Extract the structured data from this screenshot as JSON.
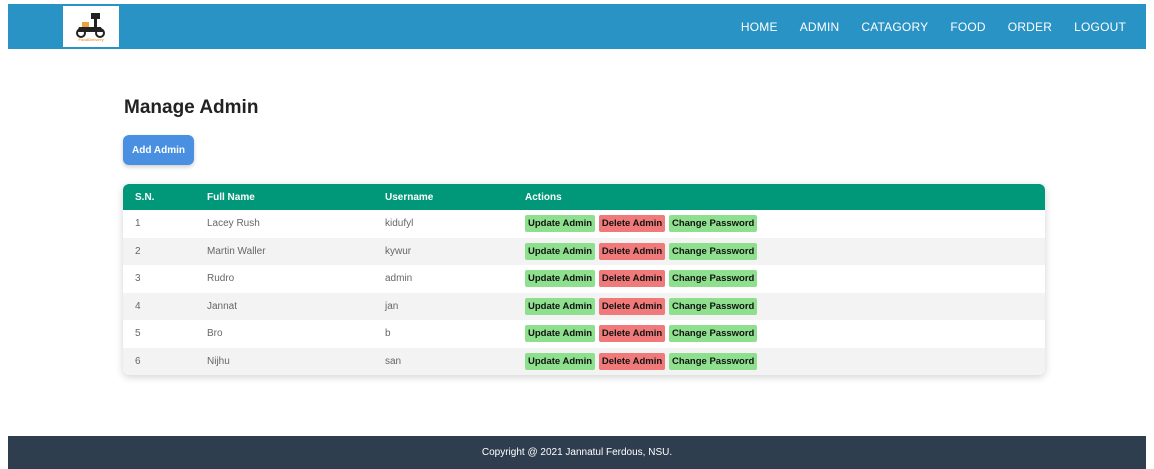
{
  "brand": {
    "logo_text": "FoodDelivery",
    "accent": "#2a93c5"
  },
  "nav": {
    "items": [
      {
        "label": "HOME"
      },
      {
        "label": "ADMIN"
      },
      {
        "label": "CATAGORY"
      },
      {
        "label": "FOOD"
      },
      {
        "label": "ORDER"
      },
      {
        "label": "LOGOUT"
      }
    ]
  },
  "main": {
    "title": "Manage Admin",
    "add_button": "Add Admin",
    "table": {
      "headers": [
        "S.N.",
        "Full Name",
        "Username",
        "Actions"
      ],
      "rows": [
        {
          "sn": "1",
          "full_name": "Lacey Rush",
          "username": "kidufyl"
        },
        {
          "sn": "2",
          "full_name": "Martin Waller",
          "username": "kywur"
        },
        {
          "sn": "3",
          "full_name": "Rudro",
          "username": "admin"
        },
        {
          "sn": "4",
          "full_name": "Jannat",
          "username": "jan"
        },
        {
          "sn": "5",
          "full_name": "Bro",
          "username": "b"
        },
        {
          "sn": "6",
          "full_name": "Nijhu",
          "username": "san"
        }
      ],
      "actions": {
        "update": "Update Admin",
        "delete": "Delete Admin",
        "change_password": "Change Password"
      },
      "header_color": "#009879"
    }
  },
  "footer": {
    "text": "Copyright @ 2021 Jannatul Ferdous, NSU."
  }
}
